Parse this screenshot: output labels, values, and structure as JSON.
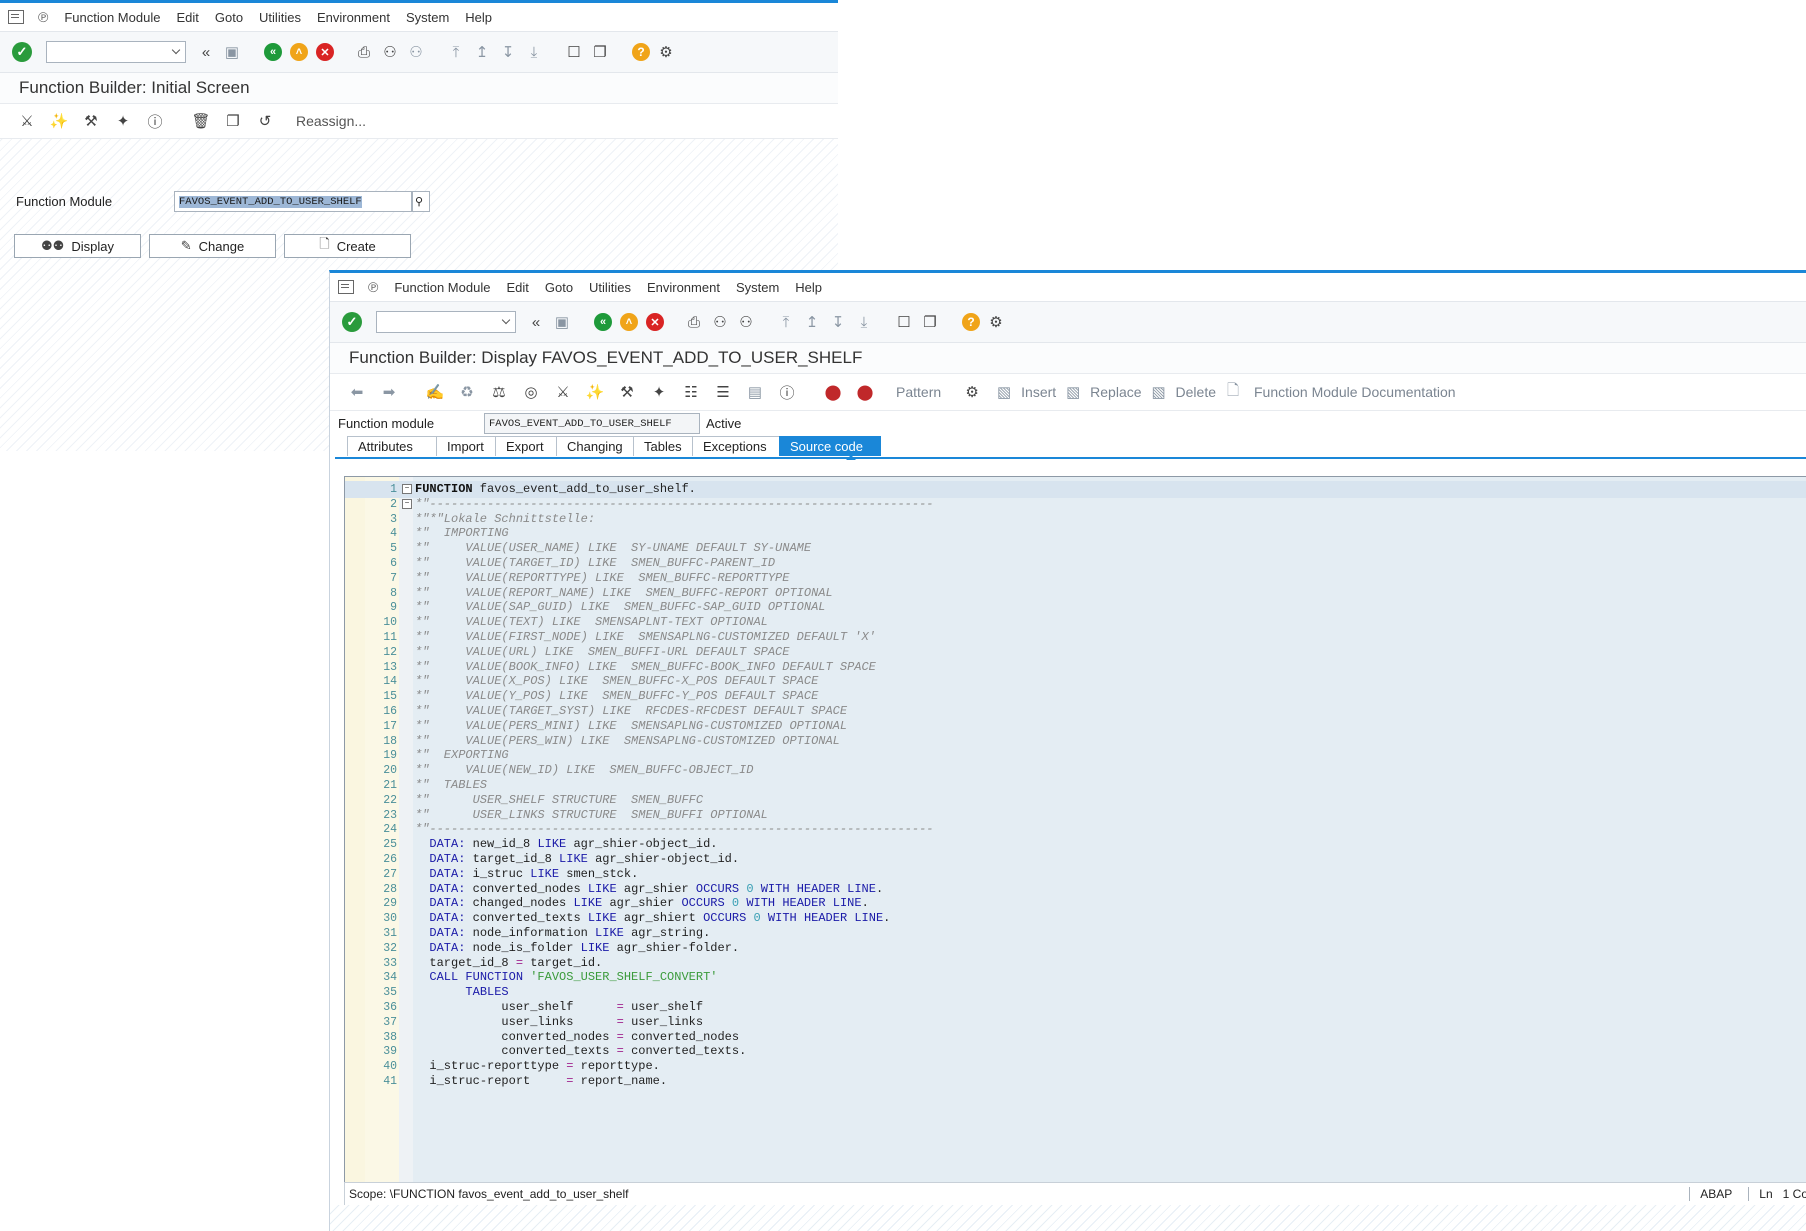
{
  "menu": [
    "Function Module",
    "Edit",
    "Goto",
    "Utilities",
    "Environment",
    "System",
    "Help"
  ],
  "screen1": {
    "title": "Function Builder: Initial Screen",
    "reassign_label": "Reassign...",
    "fm_label": "Function Module",
    "fm_value": "FAVOS_EVENT_ADD_TO_USER_SHELF",
    "buttons": {
      "display": "Display",
      "change": "Change",
      "create": "Create"
    }
  },
  "screen2": {
    "title": "Function Builder: Display FAVOS_EVENT_ADD_TO_USER_SHELF",
    "toolbar": {
      "pattern": "Pattern",
      "insert": "Insert",
      "replace": "Replace",
      "delete": "Delete",
      "documentation": "Function Module Documentation"
    },
    "fm_label": "Function module",
    "fm_value": "FAVOS_EVENT_ADD_TO_USER_SHELF",
    "status": "Active",
    "tabs": [
      "Attributes",
      "Import",
      "Export",
      "Changing",
      "Tables",
      "Exceptions",
      "Source code"
    ],
    "active_tab": "Source code",
    "code_lines": [
      "FUNCTION favos_event_add_to_user_shelf.",
      "*\"----------------------------------------------------------------------",
      "*\"*\"Lokale Schnittstelle:",
      "*\"  IMPORTING",
      "*\"     VALUE(USER_NAME) LIKE  SY-UNAME DEFAULT SY-UNAME",
      "*\"     VALUE(TARGET_ID) LIKE  SMEN_BUFFC-PARENT_ID",
      "*\"     VALUE(REPORTTYPE) LIKE  SMEN_BUFFC-REPORTTYPE",
      "*\"     VALUE(REPORT_NAME) LIKE  SMEN_BUFFC-REPORT OPTIONAL",
      "*\"     VALUE(SAP_GUID) LIKE  SMEN_BUFFC-SAP_GUID OPTIONAL",
      "*\"     VALUE(TEXT) LIKE  SMENSAPLNT-TEXT OPTIONAL",
      "*\"     VALUE(FIRST_NODE) LIKE  SMENSAPLNG-CUSTOMIZED DEFAULT 'X'",
      "*\"     VALUE(URL) LIKE  SMEN_BUFFI-URL DEFAULT SPACE",
      "*\"     VALUE(BOOK_INFO) LIKE  SMEN_BUFFC-BOOK_INFO DEFAULT SPACE",
      "*\"     VALUE(X_POS) LIKE  SMEN_BUFFC-X_POS DEFAULT SPACE",
      "*\"     VALUE(Y_POS) LIKE  SMEN_BUFFC-Y_POS DEFAULT SPACE",
      "*\"     VALUE(TARGET_SYST) LIKE  RFCDES-RFCDEST DEFAULT SPACE",
      "*\"     VALUE(PERS_MINI) LIKE  SMENSAPLNG-CUSTOMIZED OPTIONAL",
      "*\"     VALUE(PERS_WIN) LIKE  SMENSAPLNG-CUSTOMIZED OPTIONAL",
      "*\"  EXPORTING",
      "*\"     VALUE(NEW_ID) LIKE  SMEN_BUFFC-OBJECT_ID",
      "*\"  TABLES",
      "*\"      USER_SHELF STRUCTURE  SMEN_BUFFC",
      "*\"      USER_LINKS STRUCTURE  SMEN_BUFFI OPTIONAL",
      "*\"----------------------------------------------------------------------",
      "  DATA: new_id_8 LIKE agr_shier-object_id.",
      "  DATA: target_id_8 LIKE agr_shier-object_id.",
      "  DATA: i_struc LIKE smen_stck.",
      "  DATA: converted_nodes LIKE agr_shier OCCURS 0 WITH HEADER LINE.",
      "  DATA: changed_nodes LIKE agr_shier OCCURS 0 WITH HEADER LINE.",
      "  DATA: converted_texts LIKE agr_shiert OCCURS 0 WITH HEADER LINE.",
      "  DATA: node_information LIKE agr_string.",
      "  DATA: node_is_folder LIKE agr_shier-folder.",
      "  target_id_8 = target_id.",
      "  CALL FUNCTION 'FAVOS_USER_SHELF_CONVERT'",
      "       TABLES",
      "            user_shelf      = user_shelf",
      "            user_links      = user_links",
      "            converted_nodes = converted_nodes",
      "            converted_texts = converted_texts.",
      "  i_struc-reporttype = reporttype.",
      "  i_struc-report     = report_name."
    ],
    "statusbar": {
      "scope": "Scope: \\FUNCTION favos_event_add_to_user_shelf",
      "lang": "ABAP",
      "ln": "Ln",
      "col": "1 Co"
    }
  }
}
